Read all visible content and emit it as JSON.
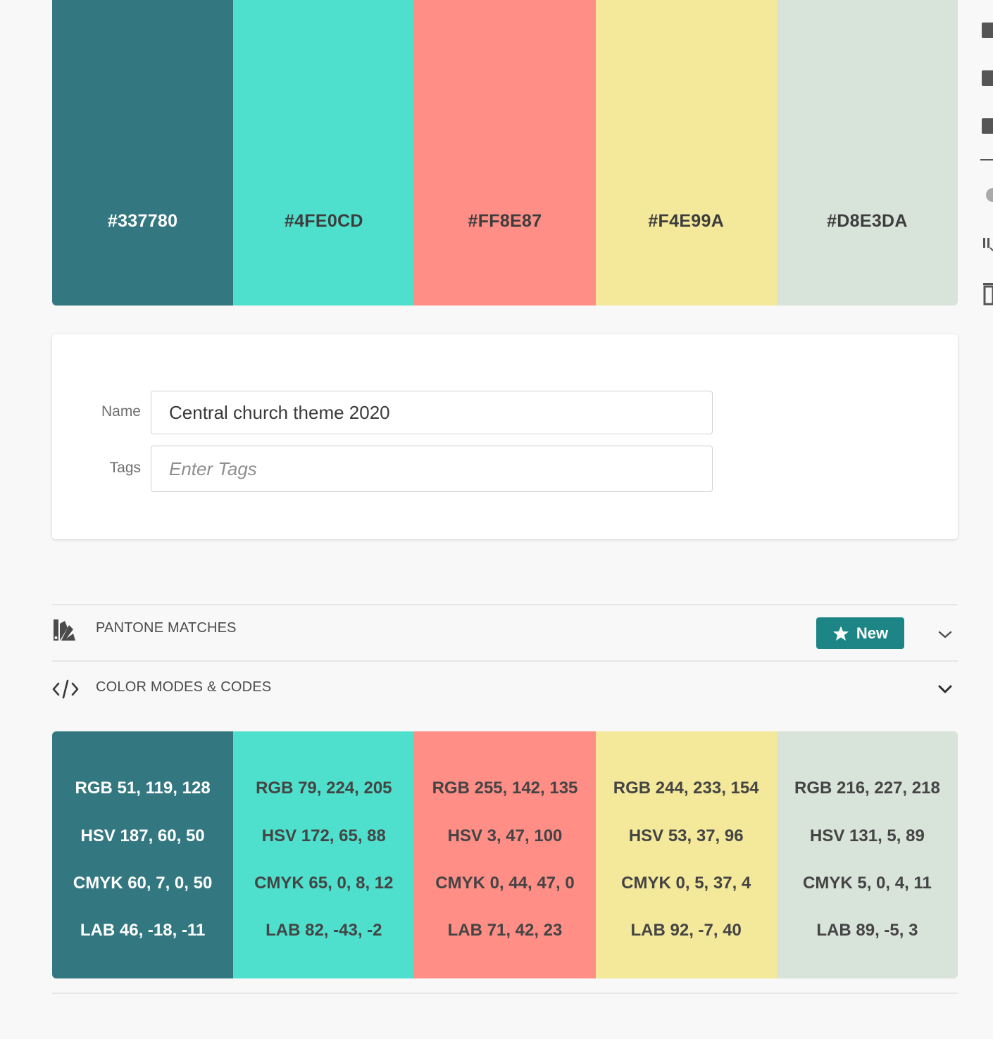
{
  "palette": {
    "swatches": [
      {
        "hex": "#337780",
        "color": "#337780",
        "text_color": "#ffffff"
      },
      {
        "hex": "#4FE0CD",
        "color": "#4FE0CD",
        "text_color": "#3d3d3d"
      },
      {
        "hex": "#FF8E87",
        "color": "#FF8E87",
        "text_color": "#3d3d3d"
      },
      {
        "hex": "#F4E99A",
        "color": "#F4E99A",
        "text_color": "#3d3d3d"
      },
      {
        "hex": "#D8E3DA",
        "color": "#D8E3DA",
        "text_color": "#3d3d3d"
      }
    ]
  },
  "form": {
    "name_label": "Name",
    "name_value": "Central church theme 2020",
    "tags_label": "Tags",
    "tags_placeholder": "Enter Tags"
  },
  "sections": {
    "pantone": {
      "title": "PANTONE MATCHES",
      "badge": "New",
      "icon": "pantone-fan-icon"
    },
    "codes": {
      "title": "COLOR MODES & CODES",
      "icon": "code-icon"
    }
  },
  "codes": [
    {
      "rgb": "RGB 51, 119, 128",
      "hsv": "HSV 187, 60, 50",
      "cmyk": "CMYK 60, 7, 0, 50",
      "lab": "LAB 46, -18, -11"
    },
    {
      "rgb": "RGB 79, 224, 205",
      "hsv": "HSV 172, 65, 88",
      "cmyk": "CMYK 65, 0, 8, 12",
      "lab": "LAB 82, -43, -2"
    },
    {
      "rgb": "RGB 255, 142, 135",
      "hsv": "HSV 3, 47, 100",
      "cmyk": "CMYK 0, 44, 47, 0",
      "lab": "LAB 71, 42, 23"
    },
    {
      "rgb": "RGB 244, 233, 154",
      "hsv": "HSV 53, 37, 96",
      "cmyk": "CMYK 0, 5, 37, 4",
      "lab": "LAB 92, -7, 40"
    },
    {
      "rgb": "RGB 216, 227, 218",
      "hsv": "HSV 131, 5, 89",
      "cmyk": "CMYK 5, 0, 4, 11",
      "lab": "LAB 89, -5, 3"
    }
  ],
  "accent_color": "#1d8585"
}
